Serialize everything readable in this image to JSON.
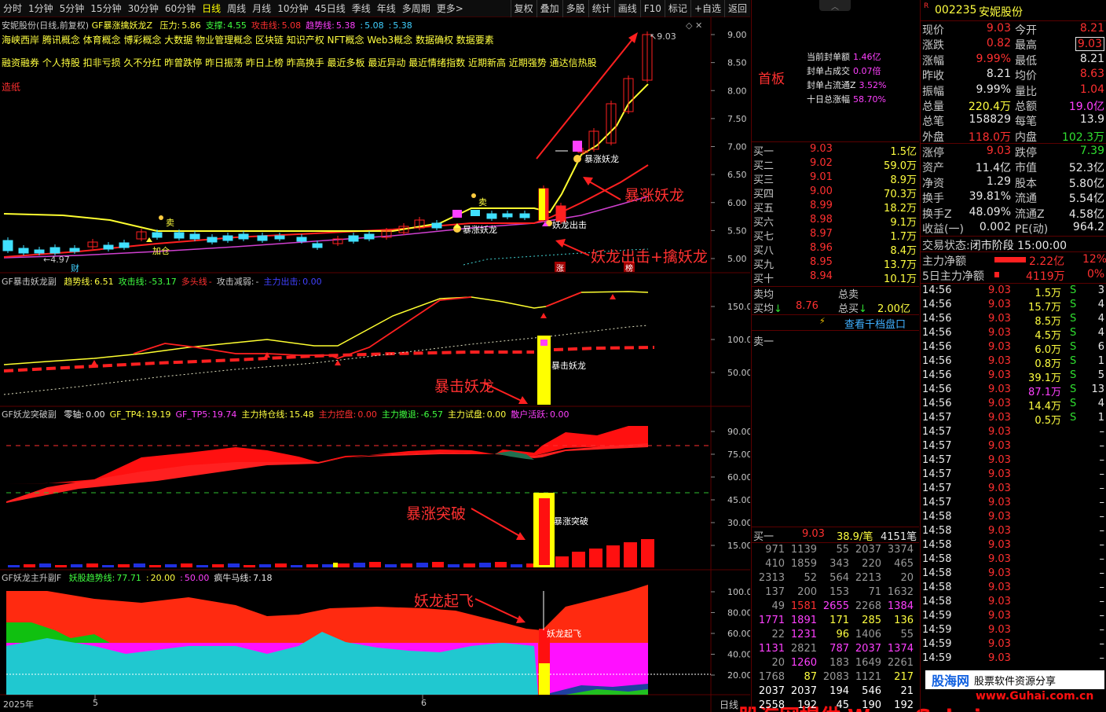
{
  "toolbar": {
    "periods": [
      "分时",
      "1分钟",
      "5分钟",
      "15分钟",
      "30分钟",
      "60分钟",
      "日线",
      "周线",
      "月线",
      "10分钟",
      "45日线",
      "季线",
      "年线",
      "多周期",
      "更多>"
    ],
    "active_period": "日线",
    "actions": [
      "复权",
      "叠加",
      "多股",
      "统计",
      "画线",
      "F10",
      "标记",
      "+自选",
      "返回"
    ]
  },
  "main_panel": {
    "stock_title": "安妮股份(日线,前复权)",
    "indicator_name": "GF暴涨擒妖龙Z",
    "params": [
      {
        "label": "压力:",
        "value": "5.86",
        "color": "#ffff40"
      },
      {
        "label": "支撑:",
        "value": "4.55",
        "color": "#40ff40"
      },
      {
        "label": "攻击线:",
        "value": "5.08",
        "color": "#ff3030"
      },
      {
        "label": "趋势线:",
        "value": "5.38",
        "color": "#ff40ff"
      },
      {
        "label": ":",
        "value": "5.08",
        "color": "#40d0ff"
      },
      {
        "label": ":",
        "value": "5.38",
        "color": "#40d0ff"
      }
    ],
    "concepts_line1": "海峡西岸 腾讯概念 体育概念 博彩概念 大数据 物业管理概念 区块链 知识产权 NFT概念 Web3概念 数据确权 数据要素",
    "concepts_line2": "融资融券 个人持股 扣非亏损 久不分红 昨曾跌停 昨日振荡 昨日上榜 昨高换手 最近多板 最近异动 最近情绪指数 近期新高 近期强势 通达信热股",
    "tag": "造纸",
    "yaxis": [
      "9.00",
      "8.50",
      "8.00",
      "7.50",
      "7.00",
      "6.50",
      "6.00",
      "5.50",
      "5.00"
    ],
    "high_label": "9.03",
    "low_label": "4.97",
    "annotations": [
      "暴涨妖龙",
      "妖龙出击+擒妖龙",
      "暴涨妖龙",
      "暴涨妖龙",
      "妖龙出击",
      "卖",
      "卖",
      "加仓"
    ],
    "markers": [
      "财",
      "涨",
      "榜"
    ]
  },
  "panel2": {
    "name": "GF暴击妖龙副",
    "params": [
      {
        "label": "趋势线:",
        "value": "6.51",
        "color": "#ffff40"
      },
      {
        "label": "攻击线:",
        "value": "-53.17",
        "color": "#40ff40"
      },
      {
        "label": "多头线",
        "value": "-",
        "color": "#ff3030"
      },
      {
        "label": "攻击减弱:",
        "value": "-",
        "color": "#c8c8c8"
      },
      {
        "label": "主力出击:",
        "value": "0.00",
        "color": "#4040ff"
      }
    ],
    "yaxis": [
      "150.0",
      "100.0",
      "50.00"
    ],
    "annotation": "暴击妖龙",
    "bar_label": "暴击妖龙"
  },
  "panel3": {
    "name": "GF妖龙突破副",
    "params": [
      {
        "label": "零轴:",
        "value": "0.00",
        "color": "#e8e8e8"
      },
      {
        "label": "GF_TP4:",
        "value": "19.19",
        "color": "#ffff40"
      },
      {
        "label": "GF_TP5:",
        "value": "19.74",
        "color": "#ff40ff"
      },
      {
        "label": "主力持仓线:",
        "value": "15.48",
        "color": "#ffff40"
      },
      {
        "label": "主力控盘:",
        "value": "0.00",
        "color": "#ff3030"
      },
      {
        "label": "主力撤退:",
        "value": "-6.57",
        "color": "#40ff40"
      },
      {
        "label": "主力试盘:",
        "value": "0.00",
        "color": "#ffff40"
      },
      {
        "label": "散户活跃:",
        "value": "0.00",
        "color": "#ff40ff"
      }
    ],
    "yaxis": [
      "90.00",
      "75.00",
      "60.00",
      "45.00",
      "30.00",
      "15.00"
    ],
    "annotation": "暴涨突破",
    "bar_label": "暴涨突破"
  },
  "panel4": {
    "name": "GF妖龙主升副F",
    "params": [
      {
        "label": "妖股趋势线:",
        "value": "77.71",
        "color": "#40ff40"
      },
      {
        "label": ":",
        "value": "20.00",
        "color": "#ffff40"
      },
      {
        "label": ":",
        "value": "50.00",
        "color": "#ff40ff"
      },
      {
        "label": "疯牛马线:",
        "value": "7.18",
        "color": "#e8e8e8"
      }
    ],
    "yaxis": [
      "100.0",
      "80.00",
      "60.00",
      "40.00",
      "20.00"
    ],
    "annotation": "妖龙起飞",
    "bar_label": "妖龙起飞"
  },
  "xaxis": {
    "labels": [
      "2025年",
      "5",
      "6"
    ],
    "period": "日线"
  },
  "mid": {
    "title": "首板",
    "seal": [
      {
        "label": "当前封单额",
        "value": "1.46亿"
      },
      {
        "label": "封单占成交",
        "value": "0.07倍"
      },
      {
        "label": "封单占流通Z",
        "value": "3.52%"
      },
      {
        "label": "十日总涨幅",
        "value": "58.70%"
      }
    ],
    "bids": [
      {
        "label": "买一",
        "price": "9.03",
        "vol": "1.5亿"
      },
      {
        "label": "买二",
        "price": "9.02",
        "vol": "59.0万"
      },
      {
        "label": "买三",
        "price": "9.01",
        "vol": "8.9万"
      },
      {
        "label": "买四",
        "price": "9.00",
        "vol": "70.3万"
      },
      {
        "label": "买五",
        "price": "8.99",
        "vol": "18.2万"
      },
      {
        "label": "买六",
        "price": "8.98",
        "vol": "9.1万"
      },
      {
        "label": "买七",
        "price": "8.97",
        "vol": "1.7万"
      },
      {
        "label": "买八",
        "price": "8.96",
        "vol": "8.4万"
      },
      {
        "label": "买九",
        "price": "8.95",
        "vol": "13.7万"
      },
      {
        "label": "买十",
        "price": "8.94",
        "vol": "10.1万"
      }
    ],
    "sell_avg": "卖均",
    "buy_avg": "买均",
    "buy_avg_price": "8.76",
    "total_sell": "总卖",
    "total_buy": "总买",
    "total_buy_val": "2.00亿",
    "view_10": "查看千档盘口",
    "sell1": "卖一",
    "buy1_row": {
      "label": "买一",
      "price": "9.03",
      "per": "38.9/笔",
      "count": "4151笔"
    },
    "queue": [
      [
        "971",
        "1139",
        "55",
        "2037",
        "3374"
      ],
      [
        "410",
        "1859",
        "343",
        "220",
        "465"
      ],
      [
        "2313",
        "52",
        "564",
        "2213",
        "20"
      ],
      [
        "137",
        "200",
        "153",
        "71",
        "1632"
      ],
      [
        "49",
        "1581",
        "2655",
        "2268",
        "1384"
      ],
      [
        "1771",
        "1891",
        "171",
        "285",
        "136"
      ],
      [
        "22",
        "1231",
        "96",
        "1406",
        "55"
      ],
      [
        "1131",
        "2821",
        "787",
        "2037",
        "1374"
      ],
      [
        "20",
        "1260",
        "183",
        "1649",
        "2261"
      ],
      [
        "1768",
        "87",
        "2083",
        "1121",
        "217"
      ],
      [
        "2037",
        "2037",
        "194",
        "546",
        "21"
      ],
      [
        "2558",
        "192",
        "45",
        "190",
        "192"
      ]
    ]
  },
  "right": {
    "code": "002235",
    "name": "安妮股份",
    "quote": [
      {
        "l1": "现价",
        "v1": "9.03",
        "l2": "今开",
        "v2": "8.21"
      },
      {
        "l1": "涨跌",
        "v1": "0.82",
        "l2": "最高",
        "v2": "9.03"
      },
      {
        "l1": "涨幅",
        "v1": "9.99%",
        "l2": "最低",
        "v2": "8.21"
      },
      {
        "l1": "昨收",
        "v1": "8.21",
        "l2": "均价",
        "v2": "8.63"
      },
      {
        "l1": "振幅",
        "v1": "9.99%",
        "l2": "量比",
        "v2": "1.04"
      },
      {
        "l1": "总量",
        "v1": "220.4万",
        "l2": "总额",
        "v2": "19.0亿"
      },
      {
        "l1": "总笔",
        "v1": "158829",
        "l2": "每笔",
        "v2": "13.9"
      },
      {
        "l1": "外盘",
        "v1": "118.0万",
        "l2": "内盘",
        "v2": "102.3万"
      }
    ],
    "fund": [
      {
        "l1": "涨停",
        "v1": "9.03",
        "l2": "跌停",
        "v2": "7.39"
      },
      {
        "l1": "资产",
        "v1": "11.4亿",
        "l2": "市值",
        "v2": "52.3亿"
      },
      {
        "l1": "净资",
        "v1": "1.29",
        "l2": "股本",
        "v2": "5.80亿"
      },
      {
        "l1": "换手",
        "v1": "39.81%",
        "l2": "流通",
        "v2": "5.54亿"
      },
      {
        "l1": "换手Z",
        "v1": "48.09%",
        "l2": "流通Z",
        "v2": "4.58亿"
      },
      {
        "l1": "收益(一)",
        "v1": "0.002",
        "l2": "PE(动)",
        "v2": "964.2"
      }
    ],
    "trade_status_label": "交易状态:",
    "trade_status": "闭市阶段 15:00:00",
    "main_net": {
      "label": "主力净额",
      "value": "2.22亿",
      "pct": "12%"
    },
    "main_net5": {
      "label": "5日主力净额",
      "value": "4119万",
      "pct": "0%"
    },
    "ticks": [
      {
        "t": "14:56",
        "p": "9.03",
        "v": "1.5万",
        "s": "S",
        "n": "3"
      },
      {
        "t": "14:56",
        "p": "9.03",
        "v": "15.7万",
        "s": "S",
        "n": "4"
      },
      {
        "t": "14:56",
        "p": "9.03",
        "v": "8.5万",
        "s": "S",
        "n": "4"
      },
      {
        "t": "14:56",
        "p": "9.03",
        "v": "4.5万",
        "s": "S",
        "n": "4"
      },
      {
        "t": "14:56",
        "p": "9.03",
        "v": "6.0万",
        "s": "S",
        "n": "6"
      },
      {
        "t": "14:56",
        "p": "9.03",
        "v": "0.8万",
        "s": "S",
        "n": "1"
      },
      {
        "t": "14:56",
        "p": "9.03",
        "v": "39.1万",
        "s": "S",
        "n": "5"
      },
      {
        "t": "14:56",
        "p": "9.03",
        "v": "87.1万",
        "s": "S",
        "n": "13"
      },
      {
        "t": "14:56",
        "p": "9.03",
        "v": "14.4万",
        "s": "S",
        "n": "4"
      },
      {
        "t": "14:57",
        "p": "9.03",
        "v": "0.5万",
        "s": "S",
        "n": "1"
      },
      {
        "t": "14:57",
        "p": "9.03",
        "v": "",
        "s": "",
        "n": "–"
      },
      {
        "t": "14:57",
        "p": "9.03",
        "v": "",
        "s": "",
        "n": "–"
      },
      {
        "t": "14:57",
        "p": "9.03",
        "v": "",
        "s": "",
        "n": "–"
      },
      {
        "t": "14:57",
        "p": "9.03",
        "v": "",
        "s": "",
        "n": "–"
      },
      {
        "t": "14:57",
        "p": "9.03",
        "v": "",
        "s": "",
        "n": "–"
      },
      {
        "t": "14:57",
        "p": "9.03",
        "v": "",
        "s": "",
        "n": "–"
      },
      {
        "t": "14:58",
        "p": "9.03",
        "v": "",
        "s": "",
        "n": "–"
      },
      {
        "t": "14:58",
        "p": "9.03",
        "v": "",
        "s": "",
        "n": "–"
      },
      {
        "t": "14:58",
        "p": "9.03",
        "v": "",
        "s": "",
        "n": "–"
      },
      {
        "t": "14:58",
        "p": "9.03",
        "v": "",
        "s": "",
        "n": "–"
      },
      {
        "t": "14:58",
        "p": "9.03",
        "v": "",
        "s": "",
        "n": "–"
      },
      {
        "t": "14:58",
        "p": "9.03",
        "v": "",
        "s": "",
        "n": "–"
      },
      {
        "t": "14:58",
        "p": "9.03",
        "v": "",
        "s": "",
        "n": "–"
      },
      {
        "t": "14:59",
        "p": "9.03",
        "v": "",
        "s": "",
        "n": "–"
      },
      {
        "t": "14:59",
        "p": "9.03",
        "v": "",
        "s": "",
        "n": "–"
      },
      {
        "t": "14:59",
        "p": "9.03",
        "v": "",
        "s": "",
        "n": "–"
      },
      {
        "t": "14:59",
        "p": "9.03",
        "v": "",
        "s": "",
        "n": "–"
      }
    ]
  },
  "watermark": {
    "brand": "股海网",
    "slogan": "股票软件资源分享",
    "url": "www.Guhai.com.cn",
    "bottom": "股海网提供 Www.Guhai.com.cn"
  },
  "colors": {
    "red": "#ff3030",
    "green": "#30e030",
    "yellow": "#ffff40",
    "cyan": "#40d0ff",
    "magenta": "#ff40ff",
    "border": "#5a0000"
  }
}
